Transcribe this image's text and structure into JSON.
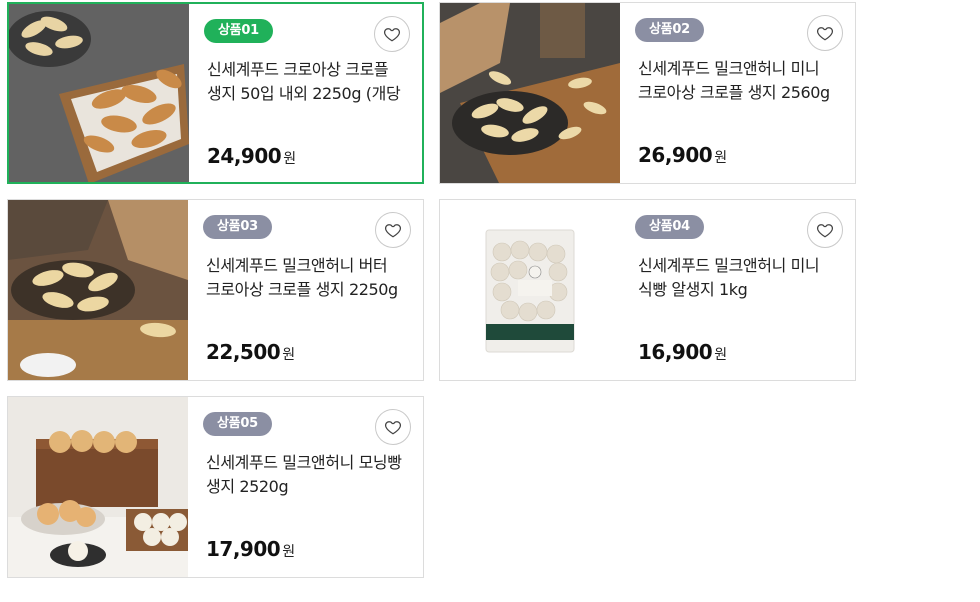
{
  "products": [
    {
      "badge": "상품01",
      "title": "신세계푸드 크로아상 크로플 생지 50입 내외 2250g (개당",
      "price": "24,900",
      "currency": "원",
      "selected": true,
      "image": "croissant-tray-photo"
    },
    {
      "badge": "상품02",
      "title": "신세계푸드 밀크앤허니 미니 크로아상 크로플 생지 2560g",
      "price": "26,900",
      "currency": "원",
      "selected": false,
      "image": "croissant-board-photo"
    },
    {
      "badge": "상품03",
      "title": "신세계푸드 밀크앤허니 버터 크로아상 크로플 생지 2250g",
      "price": "22,500",
      "currency": "원",
      "selected": false,
      "image": "butter-croissant-photo"
    },
    {
      "badge": "상품04",
      "title": "신세계푸드 밀크앤허니 미니 식빵 알생지 1kg",
      "price": "16,900",
      "currency": "원",
      "selected": false,
      "image": "dough-ball-package-photo"
    },
    {
      "badge": "상품05",
      "title": "신세계푸드 밀크앤허니 모닝빵 생지 2520g",
      "price": "17,900",
      "currency": "원",
      "selected": false,
      "image": "morning-bread-photo"
    }
  ],
  "icons": {
    "wishlist": "heart-outline-icon"
  },
  "colors": {
    "selected_border": "#20b15a",
    "badge_active": "#20b15a",
    "badge_default": "#8b8fa3"
  }
}
